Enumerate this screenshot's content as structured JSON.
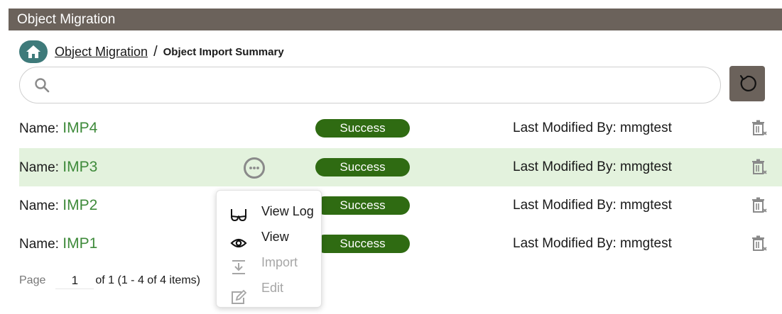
{
  "app": {
    "title": "Object Migration"
  },
  "breadcrumb": {
    "link": "Object Migration",
    "separator": "/",
    "current": "Object Import Summary"
  },
  "search": {
    "placeholder": "",
    "value": ""
  },
  "rows": [
    {
      "name_label": "Name:",
      "name": "IMP4",
      "status": "Success",
      "modified_label": "Last Modified By:",
      "modified_by": "mmgtest"
    },
    {
      "name_label": "Name:",
      "name": "IMP3",
      "status": "Success",
      "modified_label": "Last Modified By:",
      "modified_by": "mmgtest"
    },
    {
      "name_label": "Name:",
      "name": "IMP2",
      "status": "Success",
      "modified_label": "Last Modified By:",
      "modified_by": "mmgtest"
    },
    {
      "name_label": "Name:",
      "name": "IMP1",
      "status": "Success",
      "modified_label": "Last Modified By:",
      "modified_by": "mmgtest"
    }
  ],
  "pager": {
    "label": "Page",
    "page": "1",
    "info": "of 1 (1 - 4 of 4 items)"
  },
  "menu": {
    "items": [
      {
        "label": "View Log",
        "icon": "glasses-icon",
        "enabled": true
      },
      {
        "label": "View",
        "icon": "eye-icon",
        "enabled": true
      },
      {
        "label": "Import",
        "icon": "import-icon",
        "enabled": false
      },
      {
        "label": "Edit",
        "icon": "edit-icon",
        "enabled": false
      }
    ]
  },
  "colors": {
    "header": "#6b625b",
    "accent": "#3e7a7a",
    "success": "#2f6b12",
    "highlight": "#e3f2dd",
    "name": "#3e8a3a"
  },
  "icons": {
    "home": "home-icon",
    "search": "search-icon",
    "refresh": "refresh-icon",
    "delete": "delete-icon",
    "more": "more-actions-icon"
  }
}
